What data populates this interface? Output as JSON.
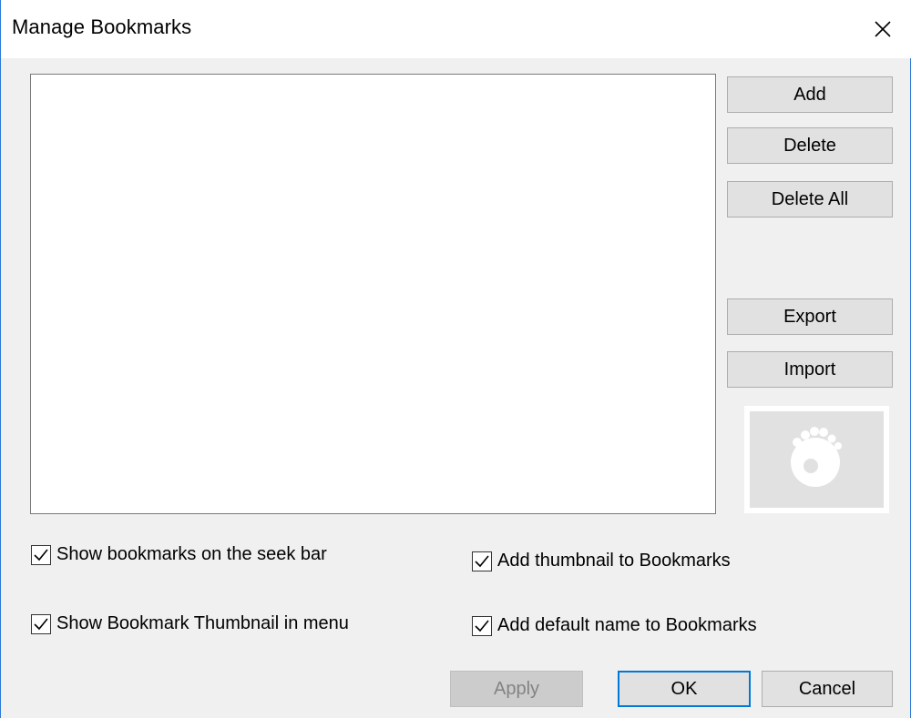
{
  "window": {
    "title": "Manage Bookmarks",
    "close_icon": "close-icon"
  },
  "bookmarks_list": {
    "items": []
  },
  "side_buttons": {
    "add": "Add",
    "delete": "Delete",
    "delete_all": "Delete All",
    "export": "Export",
    "import": "Import"
  },
  "thumbnail": {
    "icon": "gom-player-logo-icon"
  },
  "options": {
    "show_on_seek_bar": {
      "label": "Show bookmarks on the seek bar",
      "checked": true
    },
    "show_thumbnail_in_menu": {
      "label": "Show Bookmark Thumbnail in menu",
      "checked": true
    },
    "add_thumbnail": {
      "label": "Add thumbnail to Bookmarks",
      "checked": true
    },
    "add_default_name": {
      "label": "Add default name to Bookmarks",
      "checked": true
    }
  },
  "footer": {
    "apply": "Apply",
    "apply_enabled": false,
    "ok": "OK",
    "cancel": "Cancel"
  },
  "colors": {
    "accent": "#0078d7",
    "window_border": "#2b79d8",
    "background": "#f0f0f0"
  }
}
